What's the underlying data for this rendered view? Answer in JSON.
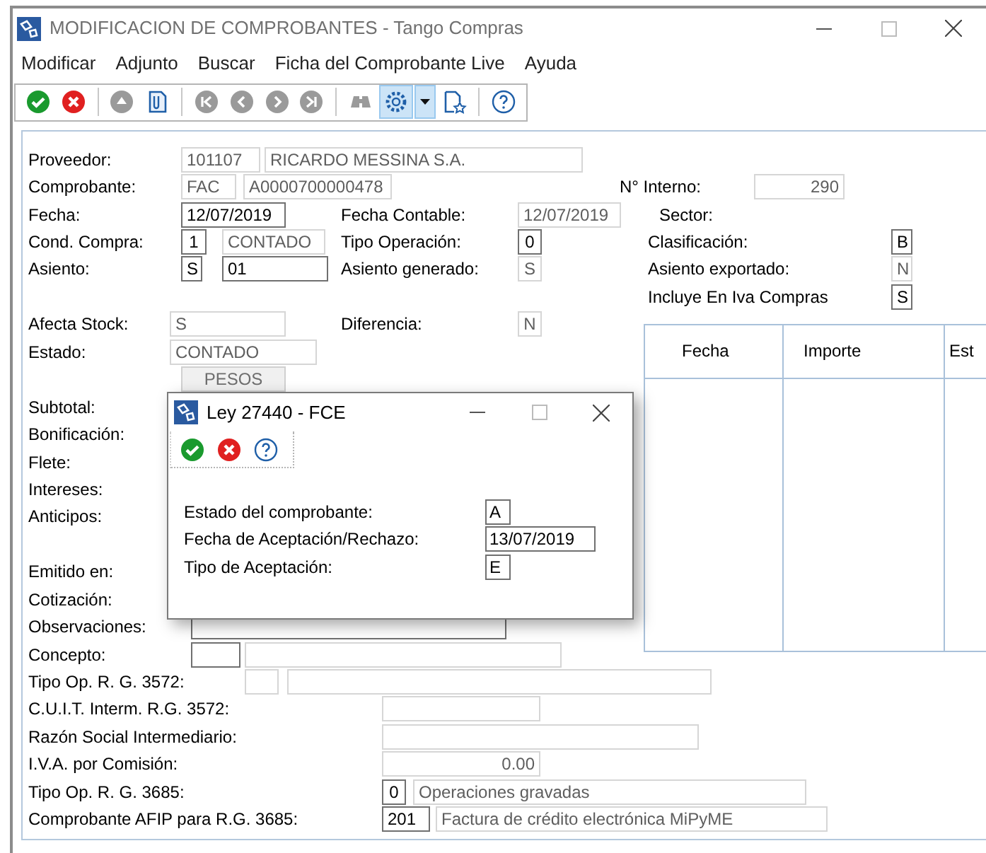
{
  "window": {
    "title": "MODIFICACION DE COMPROBANTES - Tango Compras"
  },
  "menu": [
    "Modificar",
    "Adjunto",
    "Buscar",
    "Ficha del Comprobante Live",
    "Ayuda"
  ],
  "toolbar": [
    {
      "kind": "accept",
      "disabled": false,
      "highlighted": false
    },
    {
      "kind": "cancel",
      "disabled": false,
      "highlighted": false
    },
    {
      "kind": "separator"
    },
    {
      "kind": "up",
      "disabled": true,
      "highlighted": false
    },
    {
      "kind": "attach",
      "disabled": false,
      "highlighted": false
    },
    {
      "kind": "separator"
    },
    {
      "kind": "first",
      "disabled": true,
      "highlighted": false
    },
    {
      "kind": "prev",
      "disabled": true,
      "highlighted": false
    },
    {
      "kind": "next",
      "disabled": true,
      "highlighted": false
    },
    {
      "kind": "last",
      "disabled": true,
      "highlighted": false
    },
    {
      "kind": "separator"
    },
    {
      "kind": "binoculars",
      "disabled": true,
      "highlighted": false
    },
    {
      "kind": "gear",
      "disabled": false,
      "highlighted": true
    },
    {
      "kind": "dropdown",
      "disabled": false,
      "highlighted": true
    },
    {
      "kind": "docstar",
      "disabled": false,
      "highlighted": false
    },
    {
      "kind": "separator"
    },
    {
      "kind": "help",
      "disabled": false,
      "highlighted": false
    }
  ],
  "form": {
    "rows": [
      {
        "items": [
          {
            "kind": "label",
            "text": "Proveedor:"
          },
          {
            "kind": "field",
            "value": "101107",
            "enabled": false
          },
          {
            "kind": "field",
            "value": "RICARDO MESSINA S.A.",
            "enabled": false
          }
        ]
      },
      {
        "items": [
          {
            "kind": "label",
            "text": "Comprobante:"
          },
          {
            "kind": "field",
            "value": "FAC",
            "enabled": false
          },
          {
            "kind": "field",
            "value": "A0000700000478",
            "enabled": false
          },
          {
            "kind": "label",
            "text": "N° Interno:"
          },
          {
            "kind": "field",
            "value": "290",
            "enabled": false
          }
        ]
      },
      {
        "items": [
          {
            "kind": "label",
            "text": "Fecha:"
          },
          {
            "kind": "field",
            "value": "12/07/2019",
            "enabled": true
          },
          {
            "kind": "label",
            "text": "Fecha Contable:"
          },
          {
            "kind": "field",
            "value": "12/07/2019",
            "enabled": false
          },
          {
            "kind": "label",
            "text": "Sector:"
          }
        ]
      },
      {
        "items": [
          {
            "kind": "label",
            "text": "Cond. Compra:"
          },
          {
            "kind": "field",
            "value": "1",
            "enabled": true
          },
          {
            "kind": "field",
            "value": "CONTADO",
            "enabled": false
          },
          {
            "kind": "label",
            "text": "Tipo Operación:"
          },
          {
            "kind": "field",
            "value": "0",
            "enabled": true
          },
          {
            "kind": "label",
            "text": "Clasificación:"
          },
          {
            "kind": "field",
            "value": "B",
            "enabled": true
          }
        ]
      },
      {
        "items": [
          {
            "kind": "label",
            "text": "Asiento:"
          },
          {
            "kind": "field",
            "value": "S",
            "enabled": true
          },
          {
            "kind": "field",
            "value": "01",
            "enabled": true
          },
          {
            "kind": "label",
            "text": "Asiento generado:"
          },
          {
            "kind": "field",
            "value": "S",
            "enabled": false
          },
          {
            "kind": "label",
            "text": "Asiento exportado:"
          },
          {
            "kind": "field",
            "value": "N",
            "enabled": false
          }
        ]
      },
      {
        "items": [
          {
            "kind": "label",
            "text": "Incluye En Iva Compras"
          },
          {
            "kind": "field",
            "value": "S",
            "enabled": true
          }
        ]
      },
      {
        "items": [
          {
            "kind": "label",
            "text": "Afecta Stock:"
          },
          {
            "kind": "field",
            "value": "S",
            "enabled": false
          },
          {
            "kind": "label",
            "text": "Diferencia:"
          },
          {
            "kind": "field",
            "value": "N",
            "enabled": false
          }
        ]
      },
      {
        "items": [
          {
            "kind": "label",
            "text": "Estado:"
          },
          {
            "kind": "field",
            "value": "CONTADO",
            "enabled": false
          }
        ]
      },
      {
        "items": [
          {
            "kind": "button",
            "text": "PESOS"
          }
        ]
      },
      {
        "items": [
          {
            "kind": "label",
            "text": "Subtotal:"
          }
        ]
      },
      {
        "items": [
          {
            "kind": "label",
            "text": "Bonificación:"
          }
        ]
      },
      {
        "items": [
          {
            "kind": "label",
            "text": "Flete:"
          }
        ]
      },
      {
        "items": [
          {
            "kind": "label",
            "text": "Intereses:"
          }
        ]
      },
      {
        "items": [
          {
            "kind": "label",
            "text": "Anticipos:"
          }
        ]
      },
      {
        "items": []
      },
      {
        "items": [
          {
            "kind": "label",
            "text": "Emitido en:"
          }
        ]
      },
      {
        "items": [
          {
            "kind": "label",
            "text": "Cotización:"
          }
        ]
      },
      {
        "items": [
          {
            "kind": "label",
            "text": "Observaciones:"
          },
          {
            "kind": "field",
            "enabled": true
          }
        ]
      },
      {
        "items": [
          {
            "kind": "label",
            "text": "Concepto:"
          },
          {
            "kind": "field",
            "enabled": true
          },
          {
            "kind": "field",
            "enabled": false
          }
        ]
      },
      {
        "items": [
          {
            "kind": "label",
            "text": "Tipo Op. R. G. 3572:"
          },
          {
            "kind": "field",
            "enabled": false
          },
          {
            "kind": "field",
            "enabled": false
          }
        ]
      },
      {
        "items": [
          {
            "kind": "label",
            "text": "C.U.I.T. Interm. R.G. 3572:"
          },
          {
            "kind": "field",
            "enabled": false
          }
        ]
      },
      {
        "items": [
          {
            "kind": "label",
            "text": "Razón Social Intermediario:"
          },
          {
            "kind": "field",
            "enabled": false
          }
        ]
      },
      {
        "items": [
          {
            "kind": "label",
            "text": "I.V.A. por Comisión:"
          },
          {
            "kind": "field",
            "value": "0.00",
            "enabled": false
          }
        ]
      },
      {
        "items": [
          {
            "kind": "label",
            "text": "Tipo Op. R. G. 3685:"
          },
          {
            "kind": "field",
            "value": "0",
            "enabled": true
          },
          {
            "kind": "field",
            "value": "Operaciones gravadas",
            "enabled": false
          }
        ]
      },
      {
        "items": [
          {
            "kind": "label",
            "text": "Comprobante AFIP para R.G. 3685:"
          },
          {
            "kind": "field",
            "value": "201",
            "enabled": true
          },
          {
            "kind": "field",
            "value": "Factura de crédito electrónica MiPyME",
            "enabled": false
          }
        ]
      }
    ]
  },
  "table": {
    "columns": [
      "Fecha",
      "Importe",
      "Est"
    ]
  },
  "dialog": {
    "title": "Ley 27440 - FCE",
    "toolbar": [
      {
        "kind": "accept",
        "disabled": false,
        "highlighted": false
      },
      {
        "kind": "cancel",
        "disabled": false,
        "highlighted": false
      },
      {
        "kind": "help",
        "disabled": false,
        "highlighted": false
      }
    ],
    "fields": [
      {
        "label": "Estado del comprobante:",
        "value": "A"
      },
      {
        "label": "Fecha de Aceptación/Rechazo:",
        "value": "13/07/2019"
      },
      {
        "label": "Tipo de Aceptación:",
        "value": "E"
      }
    ]
  }
}
